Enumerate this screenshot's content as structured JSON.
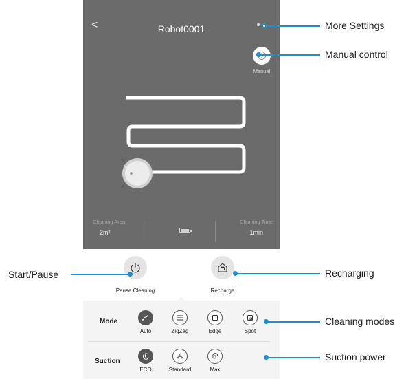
{
  "app": {
    "back_glyph": "<",
    "title": "Robot0001",
    "manual_label": "Manual"
  },
  "stats": {
    "area_label": "Cleaning Area",
    "area_value": "2m²",
    "time_label": "Cleaning Time",
    "time_value": "1min"
  },
  "actions": {
    "pause_label": "Pause Cleaning",
    "recharge_label": "Recharge"
  },
  "mode": {
    "title": "Mode",
    "options": [
      "Auto",
      "ZigZag",
      "Edge",
      "Spot"
    ],
    "selected": "Auto"
  },
  "suction": {
    "title": "Suction",
    "options": [
      "ECO",
      "Standard",
      "Max"
    ],
    "selected": "ECO"
  },
  "callouts": {
    "more_settings": "More Settings",
    "manual_control": "Manual control",
    "start_pause": "Start/Pause",
    "recharging": "Recharging",
    "cleaning_modes": "Cleaning modes",
    "suction_power": "Suction power"
  },
  "colors": {
    "screen_bg": "#6b6b6b",
    "callout": "#1a8fd1",
    "active_option": "#555555"
  }
}
